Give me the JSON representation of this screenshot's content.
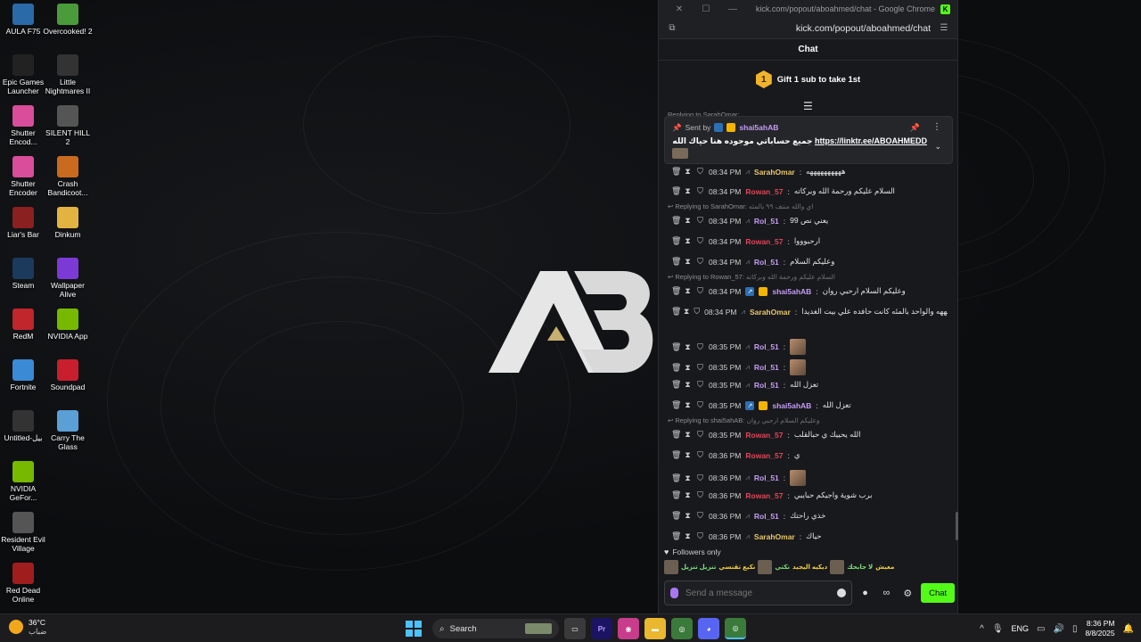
{
  "desktop": {
    "icons_col1": [
      {
        "label": "AULA F75",
        "icon": "aula-app-icon",
        "color": "#2a6aa8"
      },
      {
        "label": "Epic Games Launcher",
        "icon": "epic-games-icon",
        "color": "#222"
      },
      {
        "label": "Shutter Encod...",
        "icon": "shutter-encoder-icon",
        "color": "#d94d9a"
      },
      {
        "label": "Shutter Encoder",
        "icon": "shutter-encoder-icon",
        "color": "#d94d9a"
      },
      {
        "label": "Liar's Bar",
        "icon": "liars-bar-icon",
        "color": "#8a2020"
      },
      {
        "label": "Steam",
        "icon": "steam-icon",
        "color": "#1b3a5c"
      },
      {
        "label": "RedM",
        "icon": "redm-icon",
        "color": "#c0262c"
      },
      {
        "label": "Fortnite",
        "icon": "fortnite-icon",
        "color": "#3a8ad6"
      },
      {
        "label": "Untitled-بيل",
        "icon": "file-icon",
        "color": "#333"
      },
      {
        "label": "NVIDIA GeFor...",
        "icon": "nvidia-icon",
        "color": "#76b900"
      },
      {
        "label": "Resident Evil Village",
        "icon": "resident-evil-icon",
        "color": "#555"
      },
      {
        "label": "Red Dead Online",
        "icon": "red-dead-icon",
        "color": "#a01d1d"
      }
    ],
    "icons_col2": [
      {
        "label": "Overcooked! 2",
        "icon": "overcooked-icon",
        "color": "#4a9c3a"
      },
      {
        "label": "Little Nightmares II",
        "icon": "little-nightmares-icon",
        "color": "#333"
      },
      {
        "label": "SILENT HILL 2",
        "icon": "silent-hill-icon",
        "color": "#555"
      },
      {
        "label": "Crash Bandicoot...",
        "icon": "crash-icon",
        "color": "#c96a1e"
      },
      {
        "label": "Dinkum",
        "icon": "dinkum-icon",
        "color": "#e3b342"
      },
      {
        "label": "Wallpaper Alive",
        "icon": "wallpaper-alive-icon",
        "color": "#7b3ad6"
      },
      {
        "label": "NVIDIA App",
        "icon": "nvidia-icon",
        "color": "#76b900"
      },
      {
        "label": "Soundpad",
        "icon": "soundpad-icon",
        "color": "#c81e2e"
      },
      {
        "label": "Carry The Glass",
        "icon": "carry-glass-icon",
        "color": "#5aa0d6"
      }
    ]
  },
  "browser": {
    "window_title": "kick.com/popout/aboahmed/chat - Google Chrome",
    "url": "kick.com/popout/aboahmed/chat"
  },
  "chat": {
    "header": "Chat",
    "gift_count": "1",
    "gift_text": "Gift 1 sub to take 1st",
    "pinned": {
      "sent_by": "Sent by",
      "user": "shai5ahAB",
      "text_ar": "جميع حساباتي موجوده هنا حياك الله تابعوني",
      "link": "https://linktr.ee/ABOAHMEDD"
    },
    "ghost_reply": "Replying to SarahOmar:",
    "messages": [
      {
        "time": "08:34 PM",
        "name": "SarahOmar",
        "color": "#e8c66b",
        "badge": "og",
        "text": "ههههههههههه"
      },
      {
        "time": "08:34 PM",
        "name": "Rowan_57",
        "color": "#e0455a",
        "badge": "",
        "text": "السلام عليكم ورحمة الله وبركاته"
      },
      {
        "reply_to": "Replying to SarahOmar:",
        "reply_text": "اي والله منتف ٩٩ بالمئه"
      },
      {
        "time": "08:34 PM",
        "name": "Rol_51",
        "color": "#c59df5",
        "badge": "og",
        "text": "يعني نص 99"
      },
      {
        "time": "08:34 PM",
        "name": "Rowan_57",
        "color": "#e0455a",
        "badge": "",
        "text": "ارحبوووا"
      },
      {
        "time": "08:34 PM",
        "name": "Rol_51",
        "color": "#c59df5",
        "badge": "og",
        "text": "وعليكم السلام"
      },
      {
        "reply_to": "Replying to Rowan_57:",
        "reply_text": "السلام عليكم ورحمة الله وبركاته"
      },
      {
        "time": "08:34 PM",
        "name": "shai5ahAB",
        "color": "#c59df5",
        "badge": "owner",
        "text": "وعليكم السلام ارحبي روان"
      },
      {
        "time": "08:34 PM",
        "name": "SarahOmar",
        "color": "#e8c66b",
        "badge": "og",
        "text": "هههههههههههه والواحد بالمئه كانت حافده علي بيت الغديدا"
      },
      {
        "time": "08:35 PM",
        "name": "Rol_51",
        "color": "#c59df5",
        "badge": "og",
        "text": "",
        "emote": true
      },
      {
        "time": "08:35 PM",
        "name": "Rol_51",
        "color": "#c59df5",
        "badge": "og",
        "text": "",
        "emote": true
      },
      {
        "time": "08:35 PM",
        "name": "Rol_51",
        "color": "#c59df5",
        "badge": "og",
        "text": "تعزل الله"
      },
      {
        "time": "08:35 PM",
        "name": "shai5ahAB",
        "color": "#c59df5",
        "badge": "owner",
        "text": "تعزل الله"
      },
      {
        "reply_to": "Replying to shai5ahAB:",
        "reply_text": "وعليكم السلام ارحبي روان"
      },
      {
        "time": "08:35 PM",
        "name": "Rowan_57",
        "color": "#e0455a",
        "badge": "",
        "text": "الله يحييك ي حبالقلب"
      },
      {
        "time": "08:36 PM",
        "name": "Rowan_57",
        "color": "#e0455a",
        "badge": "",
        "text": "ي"
      },
      {
        "time": "08:36 PM",
        "name": "Rol_51",
        "color": "#c59df5",
        "badge": "og",
        "text": "",
        "emote": true
      },
      {
        "time": "08:36 PM",
        "name": "Rowan_57",
        "color": "#e0455a",
        "badge": "",
        "text": "برب شوية واجيكم حبايبي"
      },
      {
        "time": "08:36 PM",
        "name": "Rol_51",
        "color": "#c59df5",
        "badge": "og",
        "text": "خذي راحتك"
      },
      {
        "time": "08:36 PM",
        "name": "SarahOmar",
        "color": "#e8c66b",
        "badge": "og",
        "text": "حياك"
      }
    ],
    "followers_only": "Followers only",
    "strip_texts": [
      "تنزيل تنزيل",
      "نكيع تقنسي",
      "نكتي",
      "ديكيه اليجيد",
      "لا جابحك",
      "معيش"
    ],
    "input_placeholder": "Send a message",
    "send_label": "Chat",
    "accent": "#53fc18"
  },
  "taskbar": {
    "weather_temp": "36°C",
    "weather_desc": "ضباب",
    "search_label": "Search",
    "lang": "ENG",
    "time": "8:36 PM",
    "date": "8/8/2025"
  }
}
